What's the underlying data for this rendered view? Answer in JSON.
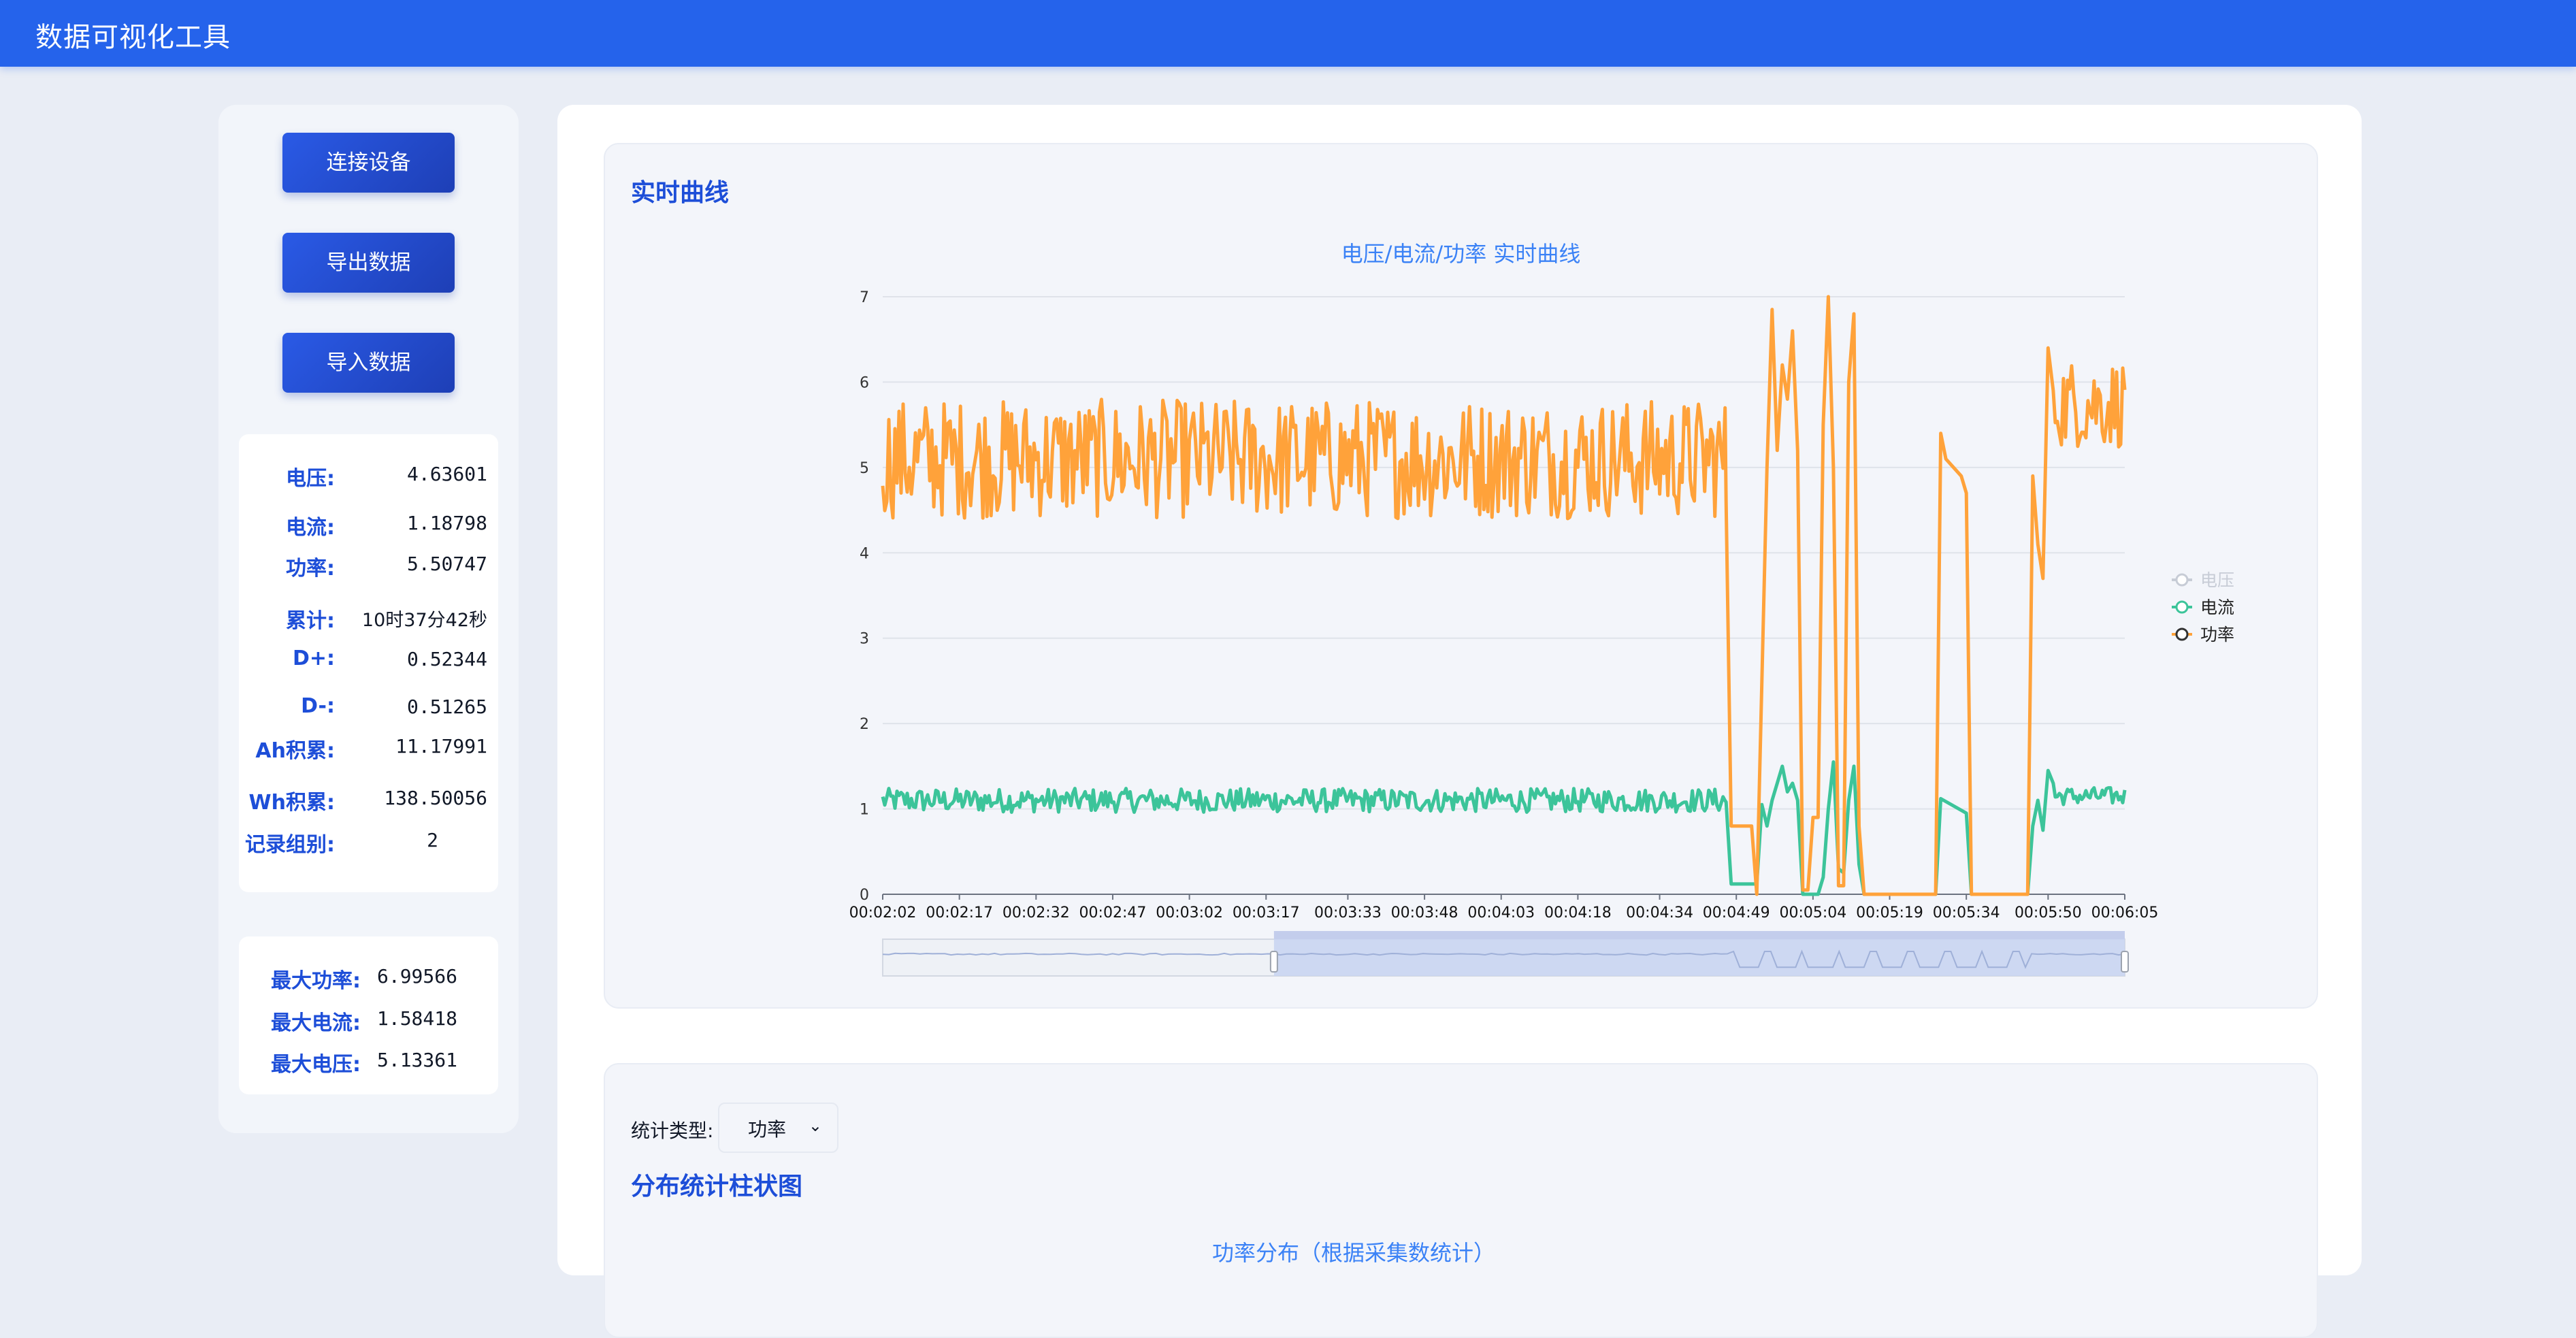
{
  "app": {
    "title": "数据可视化工具"
  },
  "sidebar": {
    "buttons": {
      "connect": "连接设备",
      "export": "导出数据",
      "import": "导入数据"
    },
    "stats": [
      {
        "label": "电压:",
        "value": "4.63601"
      },
      {
        "label": "电流:",
        "value": "1.18798"
      },
      {
        "label": "功率:",
        "value": "5.50747"
      },
      {
        "label": "累计:",
        "value": "10时37分42秒"
      },
      {
        "label": "D+:",
        "value": "0.52344"
      },
      {
        "label": "D-:",
        "value": "0.51265"
      },
      {
        "label": "Ah积累:",
        "value": "11.17991"
      },
      {
        "label": "Wh积累:",
        "value": "138.50056"
      },
      {
        "label": "记录组别:",
        "value": "2"
      }
    ],
    "maxima": [
      {
        "label": "最大功率:",
        "value": "6.99566"
      },
      {
        "label": "最大电流:",
        "value": "1.58418"
      },
      {
        "label": "最大电压:",
        "value": "5.13361"
      }
    ]
  },
  "realtime": {
    "section_title": "实时曲线",
    "zoom_range": [
      0.315,
      1.0
    ]
  },
  "distribution": {
    "type_label": "统计类型:",
    "type_value": "功率",
    "section_title": "分布统计柱状图",
    "chart_title": "功率分布（根据采集数统计）"
  },
  "chart_data": {
    "type": "line",
    "title": "电压/电流/功率 实时曲线",
    "xlabel": "",
    "ylabel": "",
    "ylim": [
      0,
      7
    ],
    "y_ticks": [
      "0",
      "1",
      "2",
      "3",
      "4",
      "5",
      "6",
      "7"
    ],
    "x_ticks": [
      "00:02:02",
      "00:02:17",
      "00:02:32",
      "00:02:47",
      "00:03:02",
      "00:03:17",
      "00:03:33",
      "00:03:48",
      "00:04:03",
      "00:04:18",
      "00:04:34",
      "00:04:49",
      "00:05:04",
      "00:05:19",
      "00:05:34",
      "00:05:50",
      "00:06:05"
    ],
    "x_range": [
      "00:02:02",
      "00:06:05"
    ],
    "grid": true,
    "legend_position": "right",
    "series": [
      {
        "name": "电压",
        "color": "#c7ccd6",
        "visible": false,
        "values": []
      },
      {
        "name": "电流",
        "color": "#3cc49a",
        "visible": true,
        "baseline": 1.1,
        "noise": 0.14,
        "values": [
          [
            "00:04:47",
            1.08
          ],
          [
            "00:04:48",
            0.12
          ],
          [
            "00:04:53",
            0.12
          ],
          [
            "00:04:54",
            1.05
          ],
          [
            "00:04:55",
            0.8
          ],
          [
            "00:04:56",
            1.1
          ],
          [
            "00:04:58",
            1.5
          ],
          [
            "00:04:59",
            1.2
          ],
          [
            "00:05:00",
            1.3
          ],
          [
            "00:05:01",
            1.1
          ],
          [
            "00:05:02",
            0.0
          ],
          [
            "00:05:05",
            0.0
          ],
          [
            "00:05:06",
            0.2
          ],
          [
            "00:05:07",
            1.0
          ],
          [
            "00:05:08",
            1.55
          ],
          [
            "00:05:09",
            0.3
          ],
          [
            "00:05:10",
            0.25
          ],
          [
            "00:05:11",
            1.1
          ],
          [
            "00:05:12",
            1.5
          ],
          [
            "00:05:13",
            0.35
          ],
          [
            "00:05:14",
            0.0
          ],
          [
            "00:05:28",
            0.0
          ],
          [
            "00:05:29",
            1.12
          ],
          [
            "00:05:34",
            0.95
          ],
          [
            "00:05:35",
            0.0
          ],
          [
            "00:05:46",
            0.0
          ],
          [
            "00:05:47",
            0.8
          ],
          [
            "00:05:48",
            1.1
          ],
          [
            "00:05:49",
            0.75
          ],
          [
            "00:05:50",
            1.45
          ],
          [
            "00:05:51",
            1.3
          ]
        ]
      },
      {
        "name": "功率",
        "color": "#ffa23a",
        "visible": true,
        "baseline": 5.1,
        "noise": 0.7,
        "values": [
          [
            "00:04:47",
            4.6
          ],
          [
            "00:04:48",
            0.8
          ],
          [
            "00:04:52",
            0.8
          ],
          [
            "00:04:53",
            0.0
          ],
          [
            "00:04:54",
            2.5
          ],
          [
            "00:04:55",
            5.0
          ],
          [
            "00:04:56",
            6.85
          ],
          [
            "00:04:57",
            5.2
          ],
          [
            "00:04:58",
            6.2
          ],
          [
            "00:04:59",
            5.8
          ],
          [
            "00:05:00",
            6.6
          ],
          [
            "00:05:01",
            5.2
          ],
          [
            "00:05:02",
            0.05
          ],
          [
            "00:05:03",
            0.05
          ],
          [
            "00:05:04",
            0.9
          ],
          [
            "00:05:05",
            0.9
          ],
          [
            "00:05:06",
            5.5
          ],
          [
            "00:05:07",
            7.0
          ],
          [
            "00:05:08",
            5.0
          ],
          [
            "00:05:09",
            0.1
          ],
          [
            "00:05:10",
            0.1
          ],
          [
            "00:05:11",
            6.0
          ],
          [
            "00:05:12",
            6.8
          ],
          [
            "00:05:13",
            0.8
          ],
          [
            "00:05:14",
            0.0
          ],
          [
            "00:05:28",
            0.0
          ],
          [
            "00:05:29",
            5.4
          ],
          [
            "00:05:30",
            5.1
          ],
          [
            "00:05:33",
            4.9
          ],
          [
            "00:05:34",
            4.7
          ],
          [
            "00:05:35",
            0.0
          ],
          [
            "00:05:46",
            0.0
          ],
          [
            "00:05:47",
            4.9
          ],
          [
            "00:05:48",
            4.1
          ],
          [
            "00:05:49",
            3.7
          ],
          [
            "00:05:50",
            6.4
          ],
          [
            "00:05:51",
            5.9
          ]
        ]
      }
    ]
  }
}
